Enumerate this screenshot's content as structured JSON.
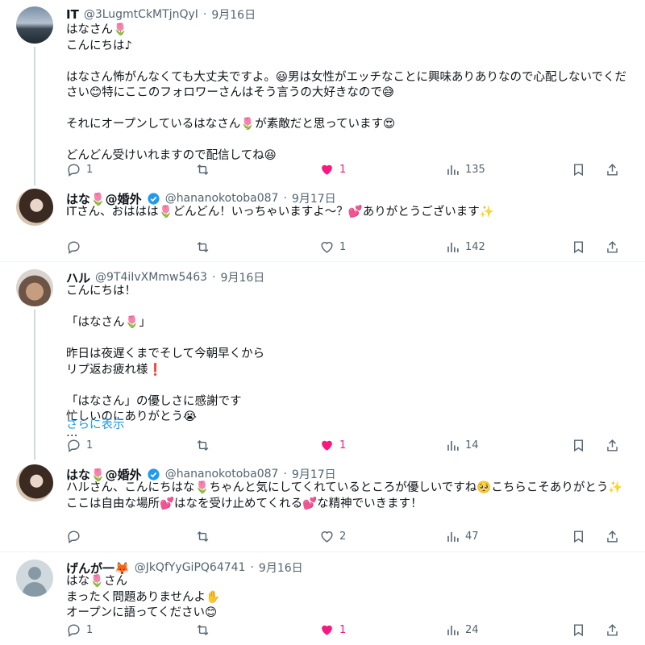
{
  "colors": {
    "like": "#f91880",
    "muted": "#536471",
    "link": "#1d9bf0",
    "verified": "#1d9bf0"
  },
  "tweets": [
    {
      "name": "IT",
      "handle": "@3LugmtCkMTjnQyI",
      "dot": "·",
      "date": "9月16日",
      "text": "はなさん🌷\nこんにちは♪\n\nはなさん怖がんなくても大丈夫ですよ。😃男は女性がエッチなことに興味ありありなので心配しないでください😊特にここのフォロワーさんはそう言うの大好きなので😅\n\nそれにオープンしているはなさん🌷が素敵だと思っています😍\n\nどんどん受けいれますので配信してね😆",
      "replies": "1",
      "retweets": "",
      "likes": "1",
      "views": "135",
      "liked": true
    },
    {
      "name": "はな🌷@婚外",
      "handle": "@hananokotoba087",
      "dot": "·",
      "date": "9月17日",
      "text": "ITさん、おははは🌷どんどん！いっちゃいますよ〜？💕ありがとうございます✨",
      "replies": "",
      "retweets": "",
      "likes": "1",
      "views": "142",
      "liked": false
    },
    {
      "name": "ハル",
      "handle": "@9T4iIvXMmw5463",
      "dot": "·",
      "date": "9月16日",
      "text": "こんにちは！\n\n「はなさん🌷」\n\n昨日は夜遅くまでそして今朝早くから\nリプ返お疲れ様❗\n\n「はなさん」の優しさに感謝です\n忙しいのにありがとう😭\n…",
      "more": "さらに表示",
      "replies": "1",
      "retweets": "",
      "likes": "1",
      "views": "14",
      "liked": true
    },
    {
      "name": "はな🌷@婚外",
      "handle": "@hananokotoba087",
      "dot": "·",
      "date": "9月17日",
      "text": "ハルさん、こんにちはな🌷ちゃんと気にしてくれているところが優しいですね🥺こちらこそありがとう✨ここは自由な場所💕はなを受け止めてくれる💕な精神でいきます！",
      "replies": "",
      "retweets": "",
      "likes": "2",
      "views": "47",
      "liked": false
    },
    {
      "name": "げんが一🦊",
      "handle": "@JkQfYyGiPQ64741",
      "dot": "·",
      "date": "9月16日",
      "text": "はな🌷さん\nまったく問題ありませんよ✋\nオープンに語ってください😊",
      "replies": "1",
      "retweets": "",
      "likes": "1",
      "views": "24",
      "liked": true
    }
  ]
}
